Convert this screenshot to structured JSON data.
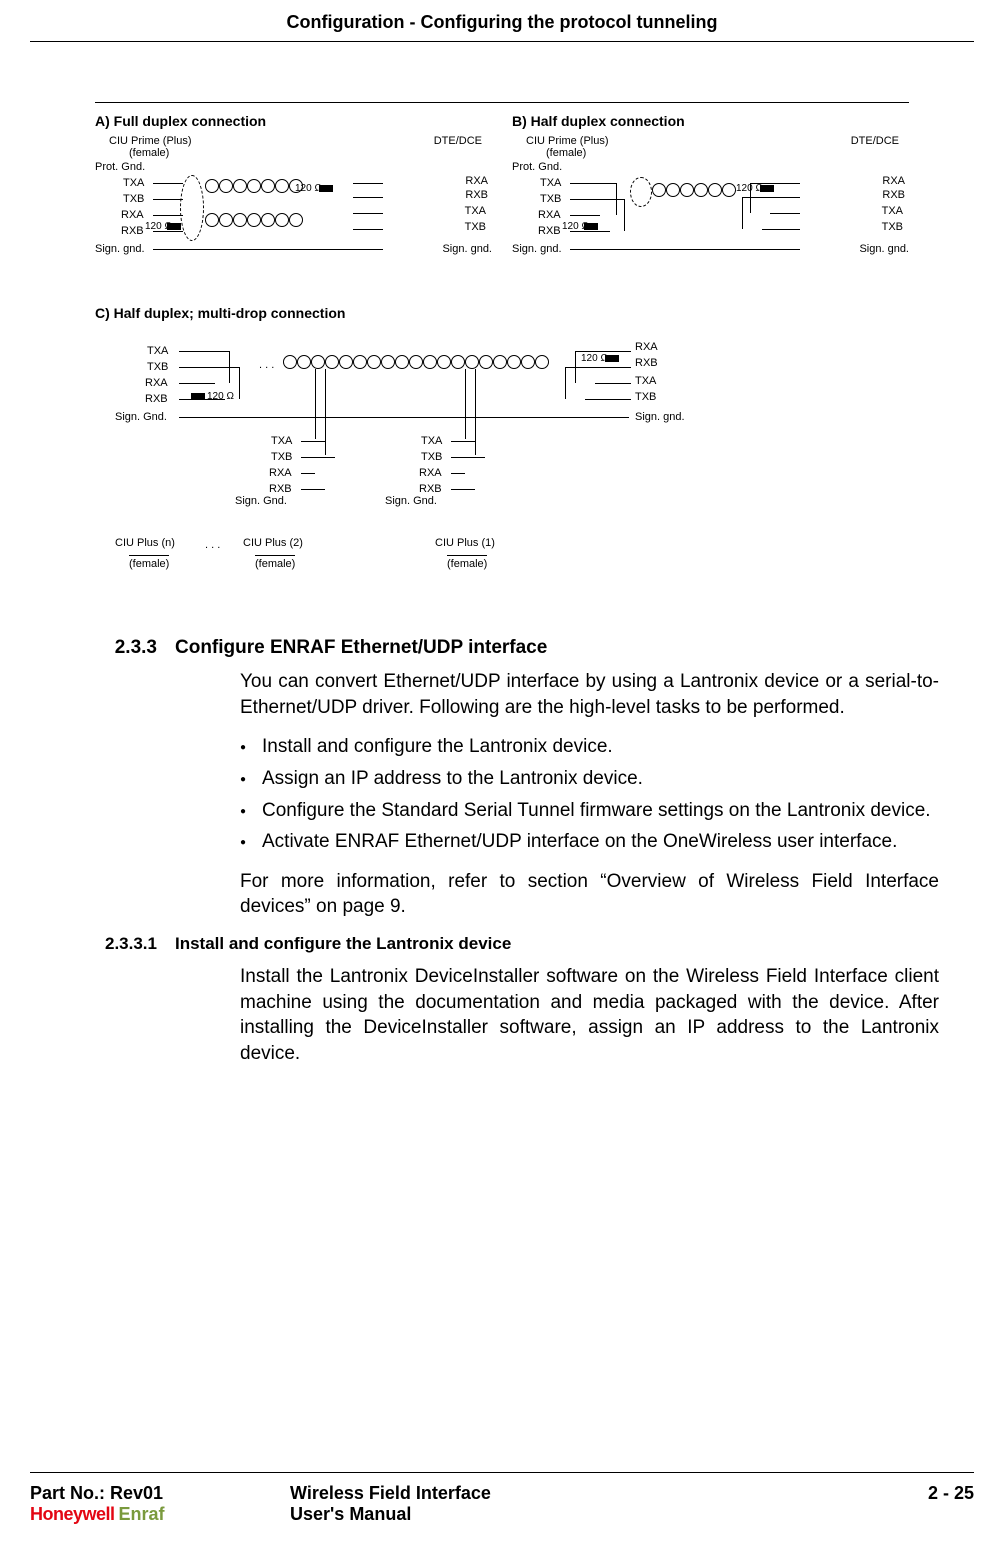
{
  "header": {
    "title": "Configuration - Configuring the protocol tunneling"
  },
  "diagram": {
    "a": {
      "title": "A)  Full duplex connection",
      "left_top": "CIU Prime (Plus)",
      "left_sub": "(female)",
      "right_top": "DTE/DCE",
      "pins_left": [
        "Prot. Gnd.",
        "TXA",
        "TXB",
        "RXA",
        "RXB",
        "Sign. gnd."
      ],
      "pins_right": [
        "RXA",
        "RXB",
        "TXA",
        "TXB",
        "Sign. gnd."
      ],
      "ohm": "120 Ω"
    },
    "b": {
      "title": "B)  Half duplex connection",
      "left_top": "CIU Prime (Plus)",
      "left_sub": "(female)",
      "right_top": "DTE/DCE",
      "pins_left": [
        "Prot. Gnd.",
        "TXA",
        "TXB",
        "RXA",
        "RXB",
        "Sign. gnd."
      ],
      "pins_right": [
        "RXA",
        "RXB",
        "TXA",
        "TXB",
        "Sign. gnd."
      ],
      "ohm": "120 Ω"
    },
    "c": {
      "title": "C)  Half duplex; multi-drop connection",
      "pins_left": [
        "TXA",
        "TXB",
        "RXA",
        "RXB",
        "Sign. Gnd."
      ],
      "pins_right": [
        "RXA",
        "RXB",
        "TXA",
        "TXB",
        "Sign. gnd."
      ],
      "drop_pins": [
        "TXA",
        "TXB",
        "RXA",
        "RXB",
        "Sign. Gnd."
      ],
      "ohm": "120 Ω",
      "bottom_labels": [
        "CIU Plus (n)",
        "CIU Plus (2)",
        "CIU Plus (1)"
      ],
      "female": "(female)",
      "dots": ". . ."
    }
  },
  "sections": {
    "s1_num": "2.3.3",
    "s1_title": "Configure ENRAF Ethernet/UDP interface",
    "s1_p1": "You can convert Ethernet/UDP interface by using a Lantronix device or a serial-to-Ethernet/UDP driver. Following are the high-level tasks to be performed.",
    "s1_bullets": [
      "Install and configure the Lantronix device.",
      "Assign an IP address to the Lantronix device.",
      "Configure the Standard Serial Tunnel firmware settings on the Lantronix device.",
      "Activate ENRAF Ethernet/UDP interface on the OneWireless user interface."
    ],
    "s1_p2": "For more information, refer to section “Overview of Wireless Field Interface devices” on page 9.",
    "s2_num": "2.3.3.1",
    "s2_title": "Install and configure the Lantronix device",
    "s2_p1": "Install the Lantronix DeviceInstaller software on the Wireless Field Interface  client machine using the documentation and media packaged with the device. After installing the DeviceInstaller software, assign an IP address to the Lantronix device."
  },
  "footer": {
    "partno": "Part No.: Rev01",
    "brand1": "Honeywell",
    "brand2": "Enraf",
    "mid1": "Wireless Field Interface",
    "mid2": "User's Manual",
    "page": "2 - 25"
  }
}
